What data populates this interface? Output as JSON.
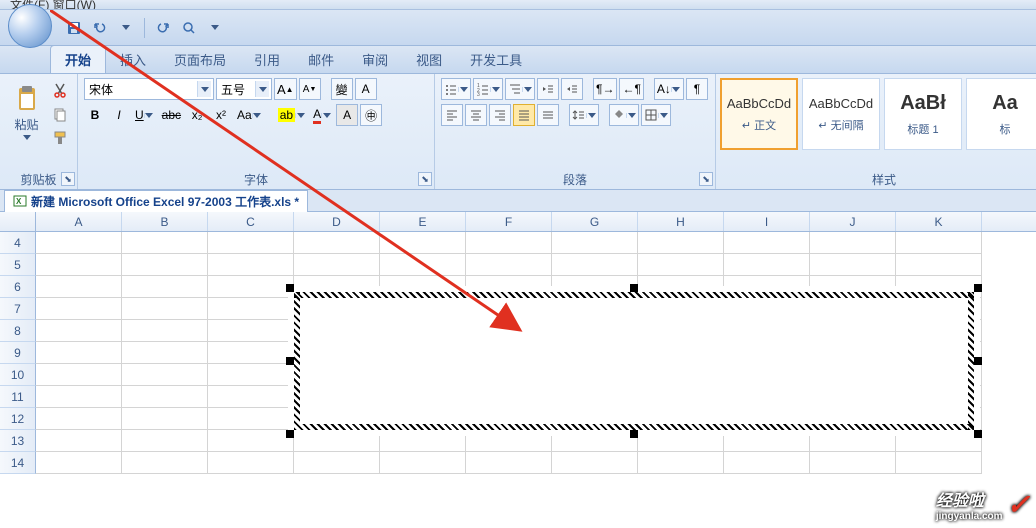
{
  "menu": {
    "file": "文件(F)",
    "window": "窗口(W)"
  },
  "tabs": [
    "开始",
    "插入",
    "页面布局",
    "引用",
    "邮件",
    "审阅",
    "视图",
    "开发工具"
  ],
  "active_tab": 0,
  "clipboard": {
    "paste": "粘贴",
    "label": "剪贴板"
  },
  "font": {
    "family": "宋体",
    "size": "五号",
    "label": "字体",
    "bold": "B",
    "italic": "I",
    "underline": "U",
    "strike": "abc",
    "sub": "x₂",
    "sup": "x²",
    "case": "Aa",
    "clear": "A"
  },
  "paragraph": {
    "label": "段落"
  },
  "styles": {
    "label": "样式",
    "items": [
      {
        "preview": "AaBbCcDd",
        "name": "↵ 正文",
        "selected": true
      },
      {
        "preview": "AaBbCcDd",
        "name": "↵ 无间隔",
        "selected": false
      },
      {
        "preview": "AaBł",
        "name": "标题 1",
        "selected": false,
        "big": true
      },
      {
        "preview": "Aa",
        "name": "标",
        "selected": false,
        "big": true
      }
    ]
  },
  "document": {
    "name": "新建 Microsoft Office Excel 97-2003 工作表.xls *"
  },
  "columns": [
    "A",
    "B",
    "C",
    "D",
    "E",
    "F",
    "G",
    "H",
    "I",
    "J",
    "K"
  ],
  "rows": [
    "4",
    "5",
    "6",
    "7",
    "8",
    "9",
    "10",
    "11",
    "12",
    "13",
    "14"
  ],
  "watermark": {
    "brand": "经验啦",
    "url": "jingyanla.com"
  }
}
